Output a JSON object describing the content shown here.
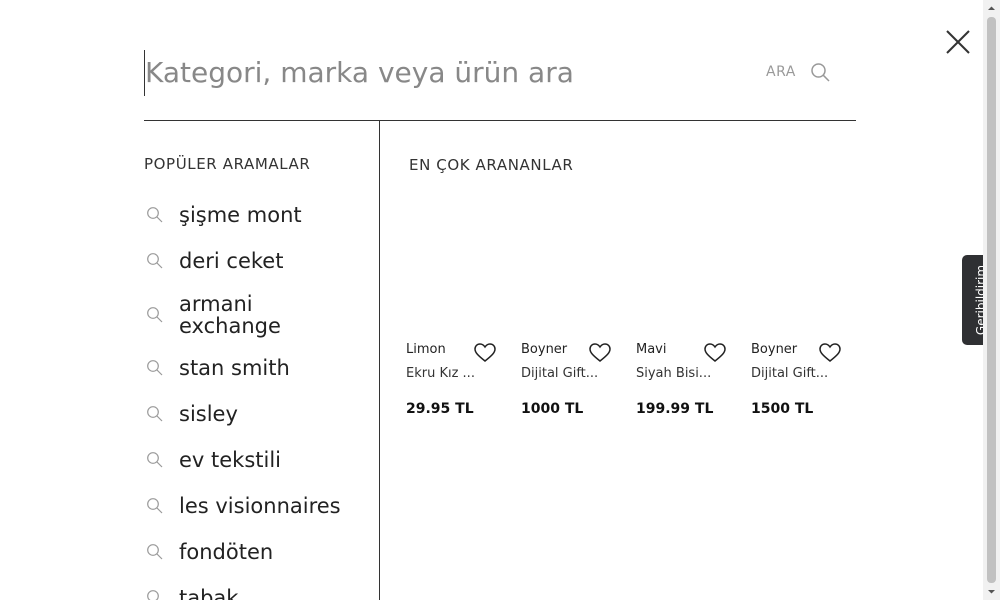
{
  "search": {
    "placeholder": "Kategori, marka veya ürün ara",
    "button_label": "ARA"
  },
  "popular": {
    "title": "POPÜLER ARAMALAR",
    "items": [
      {
        "label": "şişme mont"
      },
      {
        "label": "deri ceket"
      },
      {
        "label": "armani exchange"
      },
      {
        "label": "stan smith"
      },
      {
        "label": "sisley"
      },
      {
        "label": "ev tekstili"
      },
      {
        "label": "les visionnaires"
      },
      {
        "label": "fondöten"
      },
      {
        "label": "tabak"
      }
    ]
  },
  "most_searched": {
    "title": "EN ÇOK ARANANLAR",
    "products": [
      {
        "brand": "Limon",
        "name": "Ekru Kız ...",
        "price": "29.95 TL"
      },
      {
        "brand": "Boyner",
        "name": "Dijital Gift...",
        "price": "1000 TL"
      },
      {
        "brand": "Mavi",
        "name": "Siyah Bisi...",
        "price": "199.99 TL"
      },
      {
        "brand": "Boyner",
        "name": "Dijital Gift...",
        "price": "1500 TL"
      }
    ]
  },
  "feedback": {
    "label": "Geribildirim"
  },
  "icons": {
    "search": "search-icon",
    "close": "close-icon",
    "favorite": "heart-icon"
  },
  "colors": {
    "text": "#222222",
    "muted": "#888888",
    "divider": "#333333",
    "feedback_bg": "#2f3033"
  }
}
